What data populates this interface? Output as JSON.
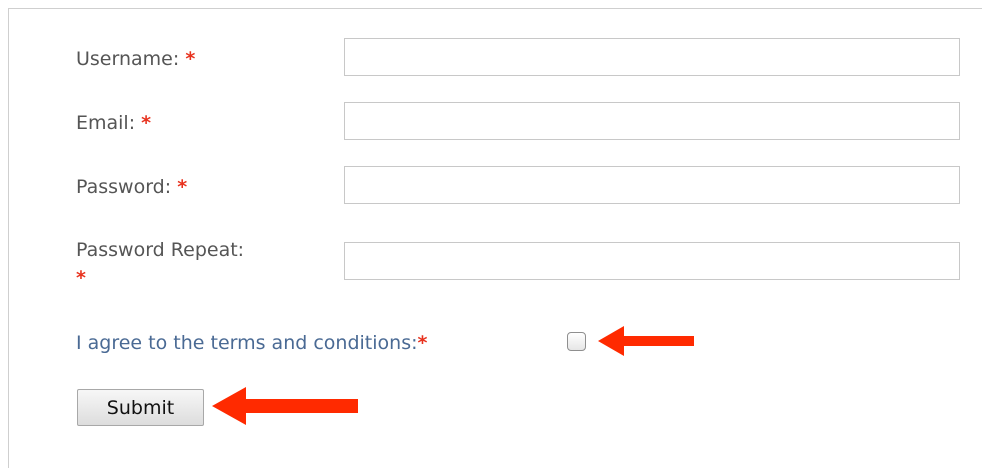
{
  "form": {
    "fields": [
      {
        "label": "Username:",
        "required_mark": "*",
        "value": "",
        "placeholder": ""
      },
      {
        "label": "Email:",
        "required_mark": "*",
        "value": "",
        "placeholder": ""
      },
      {
        "label": "Password:",
        "required_mark": "*",
        "value": "",
        "placeholder": ""
      },
      {
        "label": "Password Repeat:",
        "required_mark": "*",
        "value": "",
        "placeholder": ""
      }
    ],
    "terms": {
      "label": "I agree to the terms and conditions:",
      "required_mark": "*",
      "checked": false
    },
    "submit_label": "Submit"
  },
  "annotations": {
    "arrow_color": "#ff2a00"
  },
  "colors": {
    "required": "#e8321e",
    "label": "#555555",
    "terms_label": "#4a6a94",
    "border": "#c8c8c8"
  }
}
